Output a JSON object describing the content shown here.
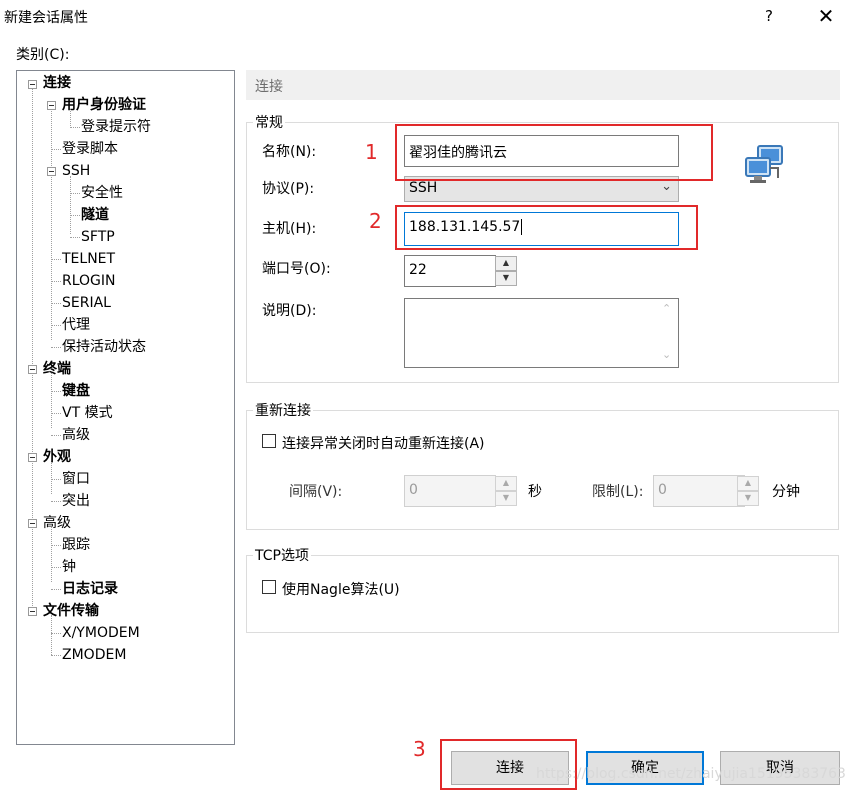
{
  "window": {
    "title": "新建会话属性",
    "help": "?",
    "close": "✕"
  },
  "category_label": "类别(C):",
  "tree": {
    "connection": "连接",
    "auth": "用户身份验证",
    "login_prompt": "登录提示符",
    "login_script": "登录脚本",
    "ssh": "SSH",
    "security": "安全性",
    "tunnel": "隧道",
    "sftp": "SFTP",
    "telnet": "TELNET",
    "rlogin": "RLOGIN",
    "serial": "SERIAL",
    "proxy": "代理",
    "keepalive": "保持活动状态",
    "terminal": "终端",
    "keyboard": "键盘",
    "vt_mode": "VT 模式",
    "advanced_term": "高级",
    "appearance": "外观",
    "window": "窗口",
    "highlight": "突出",
    "advanced": "高级",
    "trace": "跟踪",
    "bell": "钟",
    "logging": "日志记录",
    "file_transfer": "文件传输",
    "xymodem": "X/YMODEM",
    "zmodem": "ZMODEM"
  },
  "section_title": "连接",
  "general": {
    "legend": "常规",
    "name_label": "名称(N):",
    "name_value": "翟羽佳的腾讯云",
    "protocol_label": "协议(P):",
    "protocol_value": "SSH",
    "host_label": "主机(H):",
    "host_value": "188.131.145.57",
    "port_label": "端口号(O):",
    "port_value": "22",
    "desc_label": "说明(D):",
    "desc_value": ""
  },
  "reconnect": {
    "legend": "重新连接",
    "checkbox_label": "连接异常关闭时自动重新连接(A)",
    "interval_label": "间隔(V):",
    "interval_value": "0",
    "interval_unit": "秒",
    "limit_label": "限制(L):",
    "limit_value": "0",
    "limit_unit": "分钟"
  },
  "tcp": {
    "legend": "TCP选项",
    "nagle_label": "使用Nagle算法(U)"
  },
  "annotations": {
    "one": "1",
    "two": "2",
    "three": "3"
  },
  "buttons": {
    "connect": "连接",
    "ok": "确定",
    "cancel": "取消"
  },
  "watermark": "https://blog.csdn.net/zhaiyujia15195383763",
  "colors": {
    "annotation_red": "#e1292a",
    "focus_blue": "#0078d7"
  }
}
